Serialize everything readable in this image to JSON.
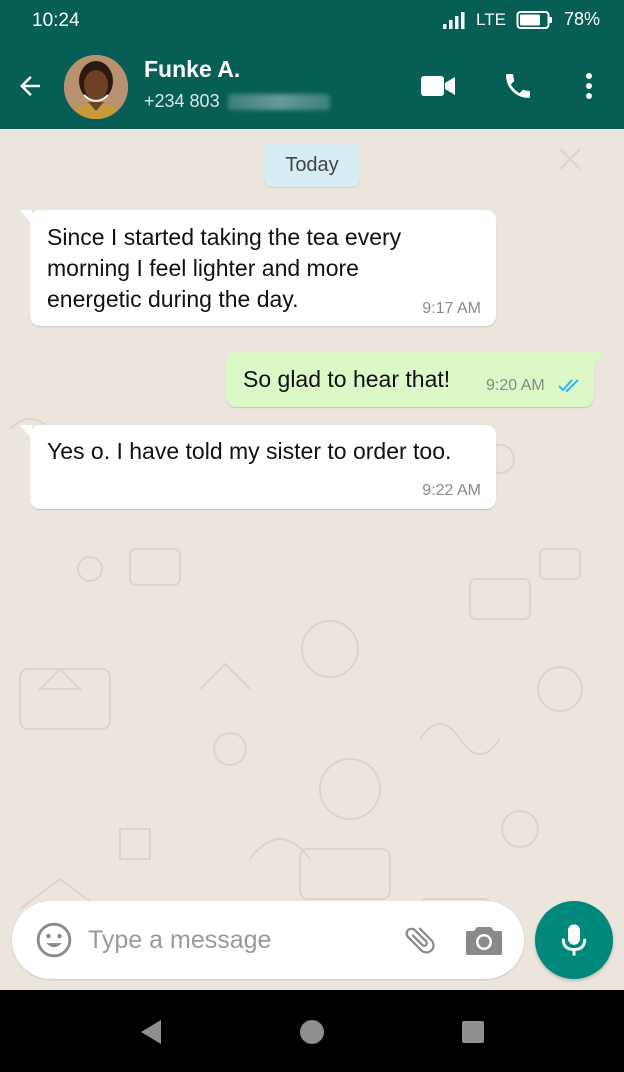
{
  "status_bar": {
    "time": "10:24",
    "network": "LTE",
    "battery": "78%"
  },
  "contact": {
    "name": "Funke A.",
    "phone_prefix": "+234 803"
  },
  "date_divider": "Today",
  "messages": [
    {
      "direction": "incoming",
      "text": "Since I started taking the tea every morning  I feel lighter and more energetic during the day.",
      "time": "9:17 AM"
    },
    {
      "direction": "outgoing",
      "text": "So glad to hear that!",
      "time": "9:20 AM",
      "status": "read"
    },
    {
      "direction": "incoming",
      "text": "Yes o. I have told my sister to order too.",
      "time": "9:22 AM"
    }
  ],
  "composer": {
    "placeholder": "Type a message"
  },
  "icons": [
    "back-arrow-icon",
    "video-call-icon",
    "phone-icon",
    "more-options-icon",
    "emoji-icon",
    "attach-icon",
    "camera-icon",
    "mic-icon",
    "nav-back-icon",
    "nav-home-icon",
    "nav-recents-icon"
  ],
  "colors": {
    "header": "#075e54",
    "chat_background": "#ece5dd",
    "outgoing_bubble": "#dcf8c6",
    "incoming_bubble": "#ffffff",
    "date_chip": "#d7ecf3",
    "mic_button": "#00897b",
    "read_ticks": "#34b7f1"
  }
}
